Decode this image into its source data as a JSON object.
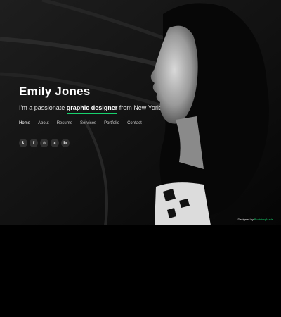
{
  "hero": {
    "name": "Emily Jones",
    "tagline_prefix": "I'm a passionate ",
    "tagline_role": "graphic designer",
    "tagline_suffix": " from New York"
  },
  "nav": {
    "items": [
      "Home",
      "About",
      "Resume",
      "Services",
      "Portfolio",
      "Contact"
    ],
    "active": "Home"
  },
  "social": {
    "icons": [
      "twitter-icon",
      "facebook-icon",
      "instagram-icon",
      "skype-icon",
      "linkedin-icon"
    ],
    "glyphs": [
      "t",
      "f",
      "◎",
      "s",
      "in"
    ]
  },
  "footer": {
    "credits_prefix": "Designed by ",
    "credits_link": "BootstrapMade"
  },
  "colors": {
    "accent": "#18d26e",
    "background": "#000000",
    "text": "#ffffff"
  }
}
